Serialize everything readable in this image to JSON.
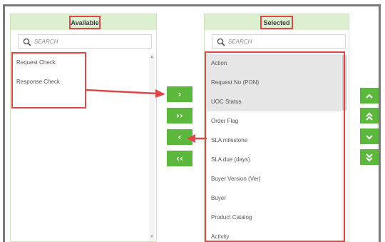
{
  "available": {
    "title": "Available",
    "search_placeholder": "SEARCH",
    "items": [
      "Request Check",
      "Response Check"
    ]
  },
  "selected": {
    "title": "Selected",
    "search_placeholder": "SEARCH",
    "items": [
      "Action",
      "Request No (PON)",
      "UOC Status",
      "Order Flag",
      "SLA milestone",
      "SLA due (days)",
      "Buyer Version (Ver)",
      "Buyer",
      "Product Catalog",
      "Activity"
    ]
  },
  "transfer_buttons": {
    "move_right": "›",
    "move_all_right": "››",
    "move_left": "‹",
    "move_all_left": "‹‹"
  },
  "order_buttons": {
    "move_up": "^",
    "move_top": "⌃⌃",
    "move_down": "⌄",
    "move_bottom": "⌄⌄"
  },
  "colors": {
    "button_green": "#5cb83c",
    "header_green": "#dcefcf",
    "annotation_red": "#e04848"
  },
  "icons": {
    "search": "search-icon"
  }
}
